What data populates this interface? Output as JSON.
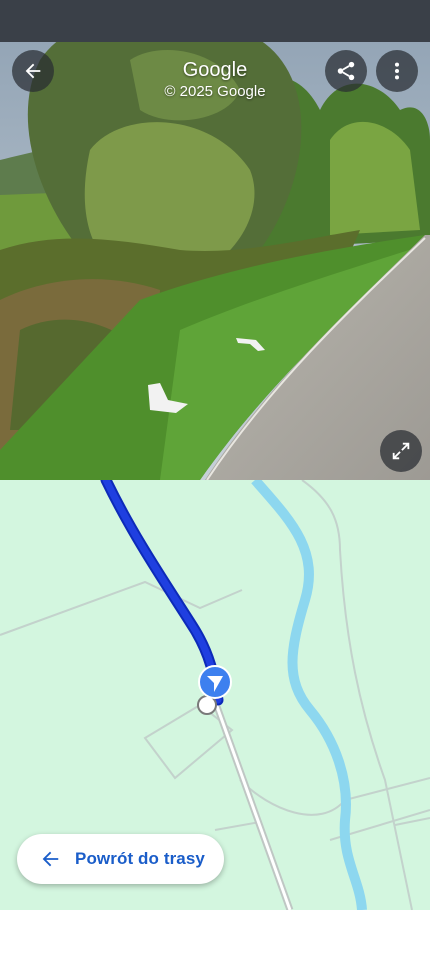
{
  "street_view": {
    "title": "Google",
    "copyright": "© 2025 Google",
    "back_icon": "arrow-left-icon",
    "share_icon": "share-icon",
    "more_icon": "more-vert-icon",
    "fullscreen_icon": "expand-icon"
  },
  "map": {
    "route_color": "#1f3fe0",
    "river_color": "#8dd7ef",
    "background_color": "#d3f6df",
    "location_icon": "navigation-arrow-icon"
  },
  "return_button": {
    "label": "Powrót do trasy",
    "icon": "arrow-left-icon"
  }
}
